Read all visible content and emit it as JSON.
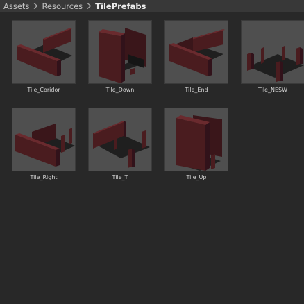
{
  "breadcrumb": {
    "items": [
      "Assets",
      "Resources",
      "TilePrefabs"
    ]
  },
  "assets": [
    {
      "name": "Tile_Coridor",
      "icon": "prefab-preview-corridor"
    },
    {
      "name": "Tile_Down",
      "icon": "prefab-preview-down"
    },
    {
      "name": "Tile_End",
      "icon": "prefab-preview-end"
    },
    {
      "name": "Tile_NESW",
      "icon": "prefab-preview-nesw"
    },
    {
      "name": "Tile_Right",
      "icon": "prefab-preview-right"
    },
    {
      "name": "Tile_T",
      "icon": "prefab-preview-t"
    },
    {
      "name": "Tile_Up",
      "icon": "prefab-preview-up"
    }
  ],
  "colors": {
    "window_bg": "#282828",
    "toolbar_bg": "#383838",
    "thumb_bg": "#4f4f4f",
    "wall_face": "#4a1c1f",
    "wall_side": "#31121a",
    "wall_top": "#6a2a2e",
    "floor": "#1f1f1f",
    "label_text": "#d2d2d2"
  }
}
